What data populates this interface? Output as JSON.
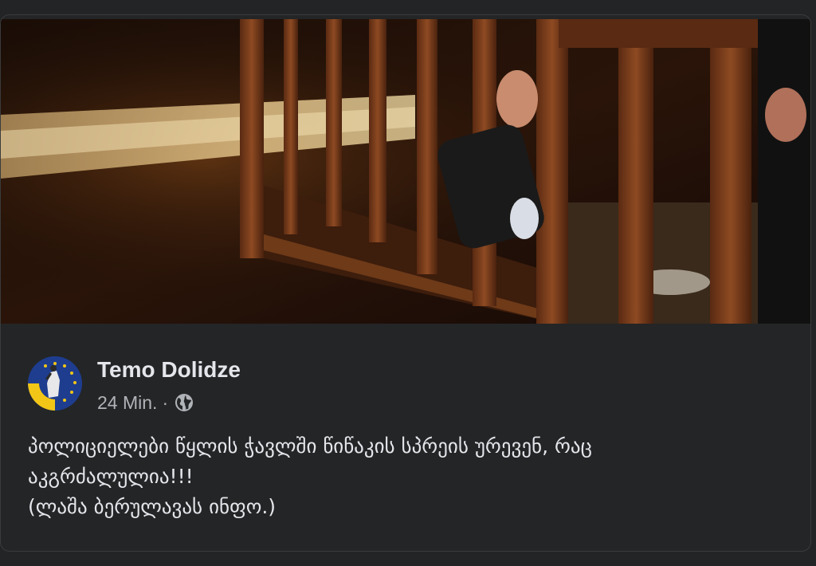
{
  "post": {
    "author": "Temo Dolidze",
    "time": "24 Min.",
    "separator": "·",
    "privacy_icon": "globe-icon",
    "text_lines": [
      "პოლიციელები წყლის ჭავლში წიწაკის სპრეის ურევენ, რაც",
      "აკგრძალულია!!!",
      "(ლაშა ბერულავას ინფო.)"
    ]
  },
  "media": {
    "description_icon": "video-thumbnail"
  },
  "colors": {
    "background": "#242526",
    "primary_text": "#e4e6eb",
    "secondary_text": "#b0b3b8"
  }
}
